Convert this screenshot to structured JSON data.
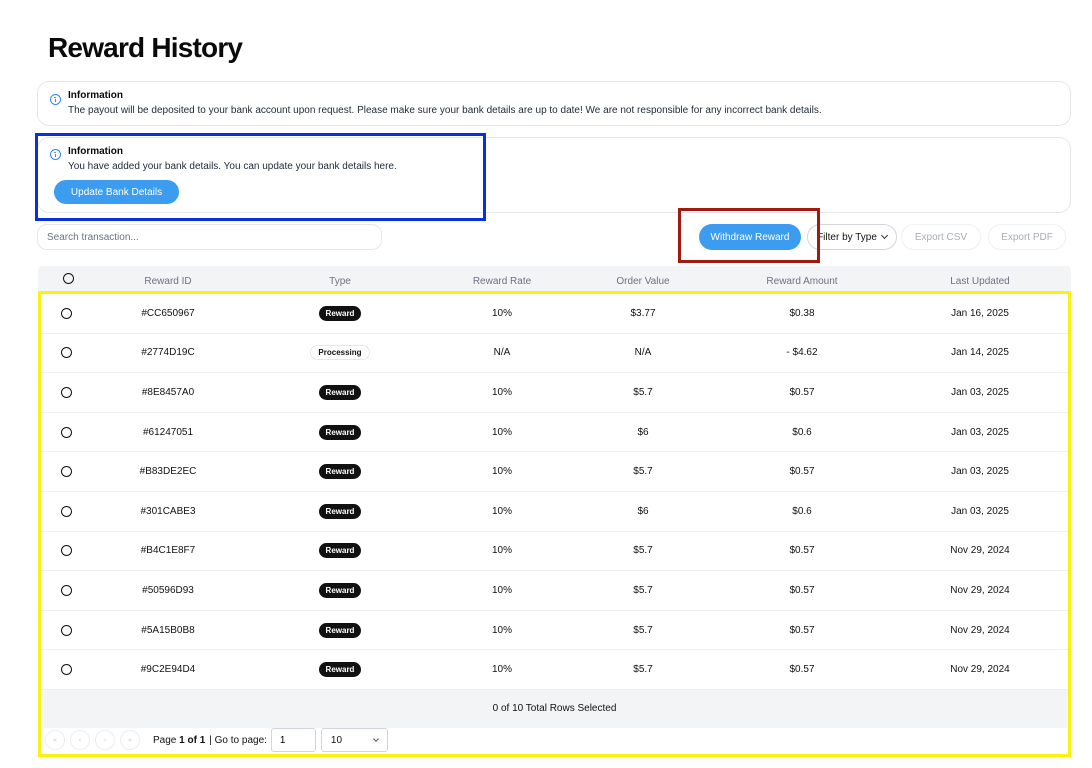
{
  "page": {
    "title": "Reward History"
  },
  "alerts": [
    {
      "title": "Information",
      "text": "The payout will be deposited to your bank account upon request. Please make sure your bank details are up to date! We are not responsible for any incorrect bank details."
    },
    {
      "title": "Information",
      "text": "You have added your bank details. You can update your bank details here.",
      "button": "Update Bank Details"
    }
  ],
  "toolbar": {
    "search_placeholder": "Search transaction...",
    "withdraw": "Withdraw Reward",
    "filter": "Filter by Type",
    "export_csv": "Export CSV",
    "export_pdf": "Export PDF"
  },
  "table": {
    "headers": [
      "Reward ID",
      "Type",
      "Reward Rate",
      "Order Value",
      "Reward Amount",
      "Last Updated"
    ],
    "rows": [
      {
        "id": "#CC650967",
        "type": "Reward",
        "rate": "10%",
        "order": "$3.77",
        "amount": "$0.38",
        "updated": "Jan 16, 2025"
      },
      {
        "id": "#2774D19C",
        "type": "Processing",
        "rate": "N/A",
        "order": "N/A",
        "amount": "- $4.62",
        "updated": "Jan 14, 2025"
      },
      {
        "id": "#8E8457A0",
        "type": "Reward",
        "rate": "10%",
        "order": "$5.7",
        "amount": "$0.57",
        "updated": "Jan 03, 2025"
      },
      {
        "id": "#61247051",
        "type": "Reward",
        "rate": "10%",
        "order": "$6",
        "amount": "$0.6",
        "updated": "Jan 03, 2025"
      },
      {
        "id": "#B83DE2EC",
        "type": "Reward",
        "rate": "10%",
        "order": "$5.7",
        "amount": "$0.57",
        "updated": "Jan 03, 2025"
      },
      {
        "id": "#301CABE3",
        "type": "Reward",
        "rate": "10%",
        "order": "$6",
        "amount": "$0.6",
        "updated": "Jan 03, 2025"
      },
      {
        "id": "#B4C1E8F7",
        "type": "Reward",
        "rate": "10%",
        "order": "$5.7",
        "amount": "$0.57",
        "updated": "Nov 29, 2024"
      },
      {
        "id": "#50596D93",
        "type": "Reward",
        "rate": "10%",
        "order": "$5.7",
        "amount": "$0.57",
        "updated": "Nov 29, 2024"
      },
      {
        "id": "#5A15B0B8",
        "type": "Reward",
        "rate": "10%",
        "order": "$5.7",
        "amount": "$0.57",
        "updated": "Nov 29, 2024"
      },
      {
        "id": "#9C2E94D4",
        "type": "Reward",
        "rate": "10%",
        "order": "$5.7",
        "amount": "$0.57",
        "updated": "Nov 29, 2024"
      }
    ],
    "footer": "0 of 10 Total Rows Selected"
  },
  "pagination": {
    "page_prefix": "Page",
    "page_current": "1 of 1",
    "goto_label": "| Go to page:",
    "goto_value": "1",
    "page_size": "10"
  },
  "colors": {
    "primary_button": "#3b9cf0",
    "highlight_blue": "#0a2fdc",
    "highlight_red": "#a01a12",
    "highlight_yellow": "#f7f20f"
  }
}
